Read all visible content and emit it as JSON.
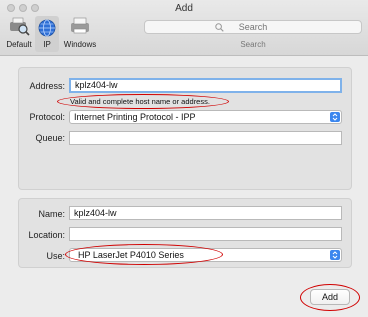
{
  "window": {
    "title": "Add"
  },
  "toolbar": {
    "items": [
      {
        "label": "Default",
        "icon": "printer-magnifier-icon"
      },
      {
        "label": "IP",
        "icon": "globe-icon"
      },
      {
        "label": "Windows",
        "icon": "windows-printer-icon"
      }
    ],
    "selected": "IP",
    "search": {
      "placeholder": "Search",
      "label": "Search"
    }
  },
  "connection": {
    "address": {
      "label": "Address:",
      "value": "kplz404-lw"
    },
    "validation_text": "Valid and complete host name or address.",
    "protocol": {
      "label": "Protocol:",
      "value": "Internet Printing Protocol - IPP"
    },
    "queue": {
      "label": "Queue:",
      "value": ""
    }
  },
  "details": {
    "name": {
      "label": "Name:",
      "value": "kplz404-lw"
    },
    "location": {
      "label": "Location:",
      "value": ""
    },
    "use": {
      "label": "Use:",
      "value": "HP LaserJet P4010 Series"
    }
  },
  "actions": {
    "add_label": "Add"
  },
  "colors": {
    "accent": "#3b86ee",
    "annotation": "#d00000",
    "focus_ring": "#7fb2ea"
  }
}
